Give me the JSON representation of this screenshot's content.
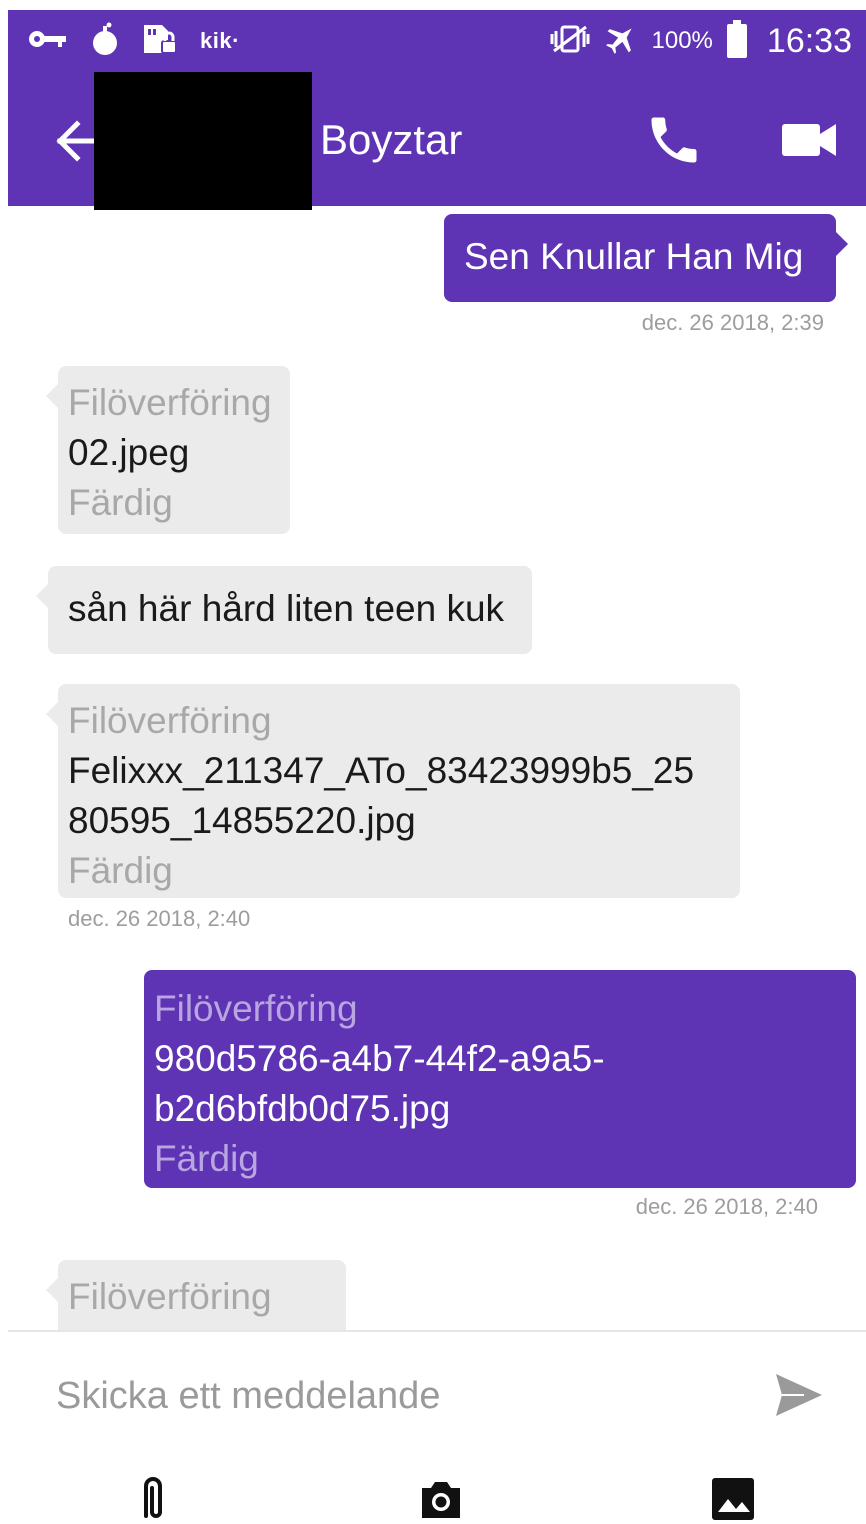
{
  "status_bar": {
    "icons": [
      "key-icon",
      "bomb-icon",
      "sd-card-lock-icon",
      "kik-notification-icon",
      "vibrate-icon",
      "airplane-mode-icon",
      "battery-icon"
    ],
    "kik": "kik·",
    "battery": "100%",
    "time": "16:33"
  },
  "header": {
    "contact_name": "Boyztar",
    "icons": [
      "back-arrow-icon",
      "phone-icon",
      "video-camera-icon"
    ]
  },
  "messages": [
    {
      "side": "out",
      "text": "Sen Knullar Han Mig",
      "timestamp": "dec. 26 2018, 2:39"
    },
    {
      "side": "in",
      "type": "file",
      "label": "Filöverföring",
      "filename": "02.jpeg",
      "status": "Färdig"
    },
    {
      "side": "in",
      "text": "sån här hård liten teen kuk"
    },
    {
      "side": "in",
      "type": "file",
      "label": "Filöverföring",
      "filename_line1": "Felixxx_211347_ATo_83423999b5_25",
      "filename_line2": "80595_14855220.jpg",
      "status": "Färdig",
      "timestamp": "dec. 26 2018, 2:40"
    },
    {
      "side": "out",
      "type": "file",
      "label": "Filöverföring",
      "filename_line1": "980d5786-a4b7-44f2-a9a5-",
      "filename_line2": "b2d6bfdb0d75.jpg",
      "status": "Färdig",
      "timestamp": "dec. 26 2018, 2:40"
    },
    {
      "side": "in",
      "type": "file",
      "label": "Filöverföring"
    }
  ],
  "compose": {
    "placeholder": "Skicka ett meddelande",
    "icons": [
      "send-icon",
      "paperclip-icon",
      "camera-icon",
      "image-icon"
    ]
  },
  "colors": {
    "accent": "#5e33b4",
    "incoming_bubble": "#ebebeb",
    "timestamp": "#9d9d9d"
  }
}
